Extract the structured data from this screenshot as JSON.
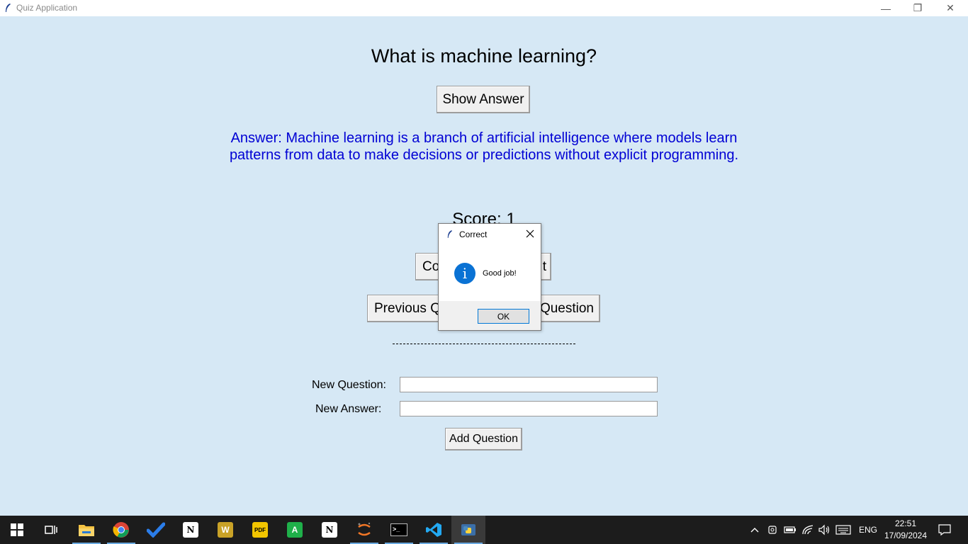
{
  "window": {
    "title": "Quiz Application",
    "minimize_glyph": "—",
    "maximize_glyph": "❐",
    "close_glyph": "✕"
  },
  "quiz": {
    "question": "What is machine learning?",
    "show_answer_label": "Show Answer",
    "answer_line1": "Answer: Machine learning is a branch of artificial intelligence where models learn",
    "answer_line2": "patterns from data to make decisions or predictions without explicit programming.",
    "score_text": "Score: 1",
    "check_button_visible": "Co",
    "check_button_visible_end": "t",
    "prev_button_visible": "Previous Q",
    "next_button_visible": "Question",
    "new_question_label": "New Question:",
    "new_answer_label": "New Answer:",
    "new_question_value": "",
    "new_answer_value": "",
    "add_question_label": "Add Question"
  },
  "dialog": {
    "title": "Correct",
    "message": "Good job!",
    "ok_label": "OK",
    "icon": "info-icon",
    "icon_glyph": "i"
  },
  "taskbar": {
    "apps": [
      {
        "name": "start-icon"
      },
      {
        "name": "task-view-icon"
      },
      {
        "name": "file-explorer-icon"
      },
      {
        "name": "chrome-icon"
      },
      {
        "name": "todo-icon"
      },
      {
        "name": "notion-icon",
        "glyph": "N"
      },
      {
        "name": "word-icon",
        "glyph": "W"
      },
      {
        "name": "pdf-icon",
        "glyph": "PDF"
      },
      {
        "name": "spreadsheet-icon",
        "glyph": "A"
      },
      {
        "name": "notion-icon-2",
        "glyph": "N"
      },
      {
        "name": "jupyter-icon"
      },
      {
        "name": "terminal-icon",
        "glyph": ">_"
      },
      {
        "name": "vscode-icon"
      },
      {
        "name": "python-icon"
      }
    ],
    "language": "ENG",
    "time": "22:51",
    "date": "17/09/2024"
  },
  "colors": {
    "background": "#d6e8f5",
    "answer_text": "#0000d4",
    "info_icon": "#0a72d4",
    "taskbar": "#1c1c1c"
  }
}
